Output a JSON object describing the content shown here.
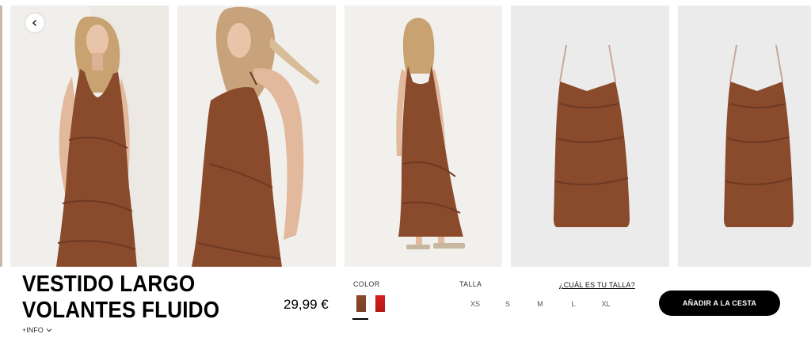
{
  "gallery": {
    "images": [
      {
        "alt": "model-front-view"
      },
      {
        "alt": "model-close-up-side-view"
      },
      {
        "alt": "model-back-view"
      },
      {
        "alt": "product-flat-front"
      },
      {
        "alt": "product-flat-back"
      }
    ]
  },
  "product": {
    "title_line1": "VESTIDO LARGO",
    "title_line2": "VOLANTES FLUIDO",
    "more_info": "+INFO",
    "price": "29,99 €"
  },
  "color": {
    "label": "COLOR",
    "options": [
      {
        "name": "brown",
        "hex": "#8a4a2c",
        "selected": true
      },
      {
        "name": "red",
        "hex": "#d11d1d",
        "selected": false
      }
    ]
  },
  "size": {
    "label": "TALLA",
    "guide_link": "¿CUÁL ES TU TALLA?",
    "options": [
      "XS",
      "S",
      "M",
      "L",
      "XL"
    ]
  },
  "cart": {
    "add_label": "AÑADIR A LA CESTA"
  },
  "colors": {
    "dress": "#8a4a2c",
    "photo_bg": "#f1efec",
    "flat_bg": "#ebebeb",
    "button_bg": "#000000"
  }
}
